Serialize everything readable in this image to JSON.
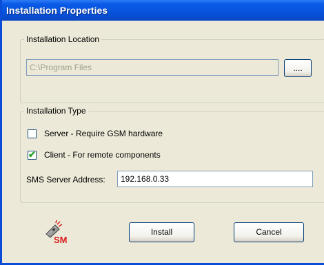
{
  "window": {
    "title": "Installation Properties"
  },
  "location": {
    "group_label": "Installation Location",
    "path_value": "C:\\Program Files",
    "browse_label": "...."
  },
  "type": {
    "group_label": "Installation Type",
    "server": {
      "label": "Server - Require GSM hardware",
      "checked": false
    },
    "client": {
      "label": "Client - For remote components",
      "checked": true
    },
    "sms_label": "SMS Server Address:",
    "sms_value": "192.168.0.33"
  },
  "logo": {
    "text": "SM"
  },
  "buttons": {
    "install": "Install",
    "cancel": "Cancel"
  },
  "colors": {
    "title_bar": "#0a5ae6",
    "dialog_bg": "#ece9d8",
    "logo_red": "#d81c1c"
  }
}
